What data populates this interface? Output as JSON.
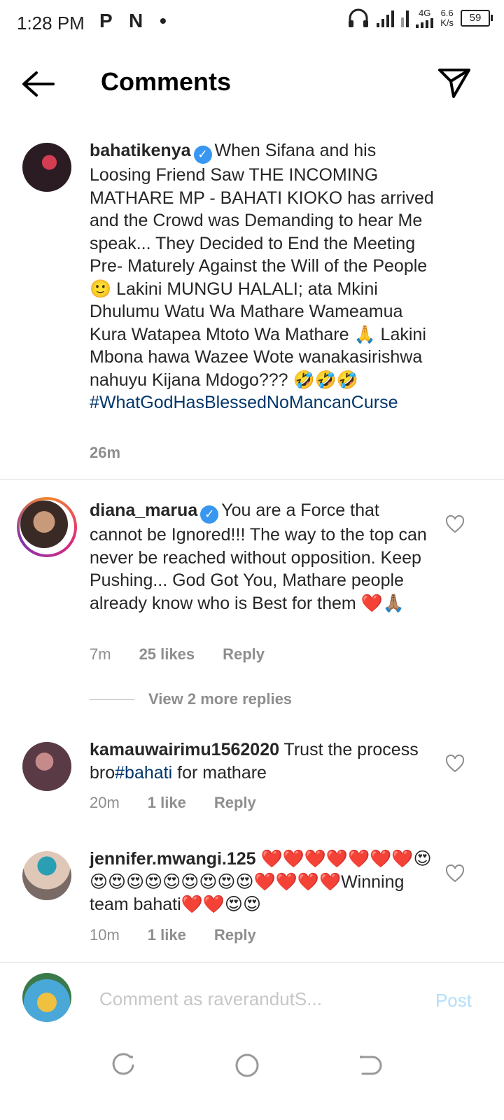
{
  "status_bar": {
    "time": "1:28 PM",
    "app_icons": "P N •",
    "network_type": "4G",
    "speed_value": "6.6",
    "speed_unit": "K/s",
    "battery": "59"
  },
  "header": {
    "title": "Comments",
    "back_icon": "arrow-left-icon",
    "share_icon": "paper-plane-icon"
  },
  "caption": {
    "username": "bahatikenya",
    "text": "When Sifana and his Loosing Friend Saw THE INCOMING MATHARE MP - BAHATI KIOKO has arrived and the Crowd was Demanding to hear Me speak... They Decided to End the Meeting Pre- Maturely Against the Will of the People 🙂 Lakini MUNGU HALALI; ata Mkini Dhulumu Watu Wa Mathare Wameamua Kura Watapea Mtoto Wa Mathare 🙏 Lakini Mbona hawa Wazee Wote wanakasirishwa nahuyu Kijana Mdogo??? 🤣🤣🤣",
    "hashtag": "#WhatGodHasBlessedNoMancanCurse",
    "time": "26m"
  },
  "comments": [
    {
      "username": "diana_marua",
      "text": "You are a Force that cannot be Ignored!!! The way to the top can never be reached without opposition. Keep Pushing... God Got You, Mathare people already know who is Best for them ❤️🙏🏽",
      "time": "7m",
      "likes": "25 likes",
      "reply": "Reply"
    },
    {
      "username": "kamauwairimu1562020",
      "text_before": "Trust the process bro",
      "hashtag": "#bahati",
      "text_after": " for mathare",
      "time": "20m",
      "likes": "1 like",
      "reply": "Reply"
    },
    {
      "username": "jennifer.mwangi.125",
      "text": "❤️❤️❤️❤️❤️❤️❤️😍😍😍😍😍😍😍😍😍😍❤️❤️❤️❤️Winning team bahati❤️❤️😍😍",
      "time": "10m",
      "likes": "1 like",
      "reply": "Reply"
    }
  ],
  "view_replies": "View 2 more replies",
  "input": {
    "placeholder": "Comment as raverandutS...",
    "post_label": "Post"
  },
  "colors": {
    "verified": "#3897f0",
    "hashtag": "#00376b",
    "secondary_text": "#8e8e8e",
    "post_disabled": "#b2dffc"
  }
}
